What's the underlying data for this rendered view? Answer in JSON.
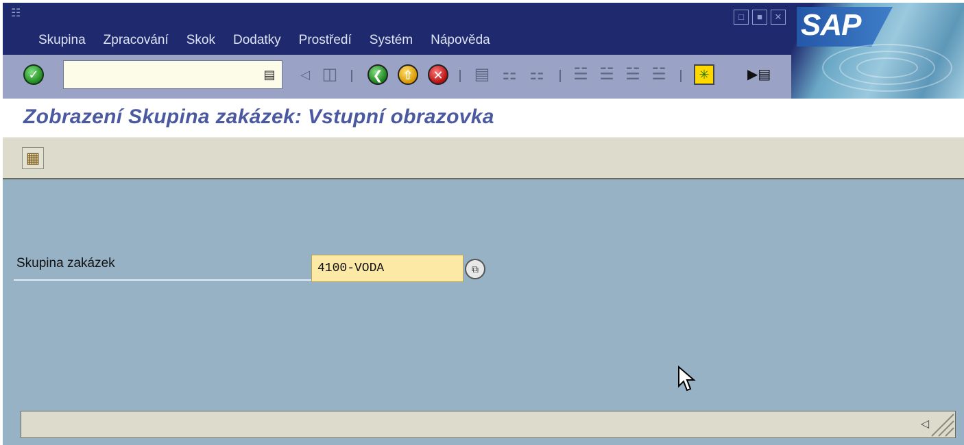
{
  "menubar": {
    "items": [
      {
        "label": "Skupina"
      },
      {
        "label": "Zpracování"
      },
      {
        "label": "Skok"
      },
      {
        "label": "Dodatky"
      },
      {
        "label": "Prostředí"
      },
      {
        "label": "Systém"
      },
      {
        "label": "Nápověda"
      }
    ]
  },
  "branding": {
    "logo_text": "SAP"
  },
  "toolbar": {
    "command_field_value": "",
    "icons": [
      "enter-icon",
      "command-dropdown-icon",
      "back-arrow-icon",
      "save-icon",
      "back-icon",
      "exit-icon",
      "cancel-icon",
      "print-icon",
      "find-icon",
      "find-next-icon",
      "first-page-icon",
      "previous-page-icon",
      "next-page-icon",
      "last-page-icon",
      "create-session-icon",
      "shortcut-icon"
    ]
  },
  "title": {
    "text": "Zobrazení Skupina zakázek: Vstupní obrazovka"
  },
  "app_toolbar": {
    "icons": [
      "hierarchy-icon"
    ]
  },
  "form": {
    "label": "Skupina zakázek",
    "value": "4100-VODA"
  },
  "colors": {
    "menubar_bg": "#1f2a6e",
    "title_text": "#4b5aa0",
    "content_bg": "#96b2c4",
    "input_bg": "#fde9a6"
  }
}
